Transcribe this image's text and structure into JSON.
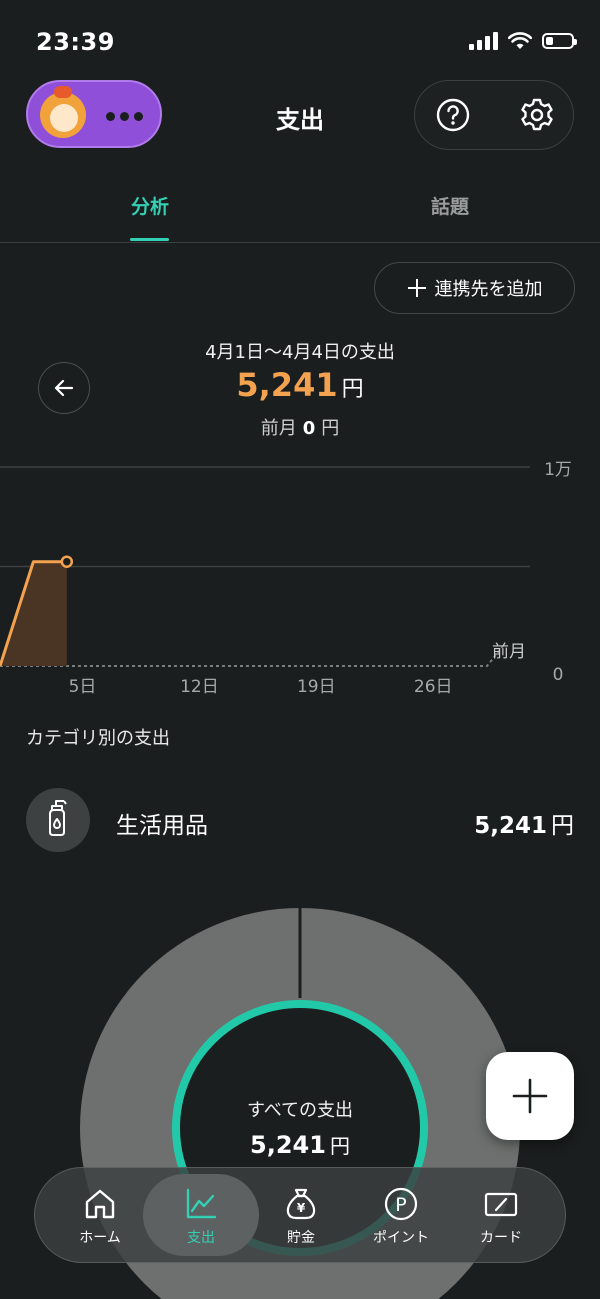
{
  "status_bar": {
    "time": "23:39",
    "battery_level": 0.3
  },
  "header": {
    "title": "支出",
    "icons": [
      "help-icon",
      "gear-icon"
    ],
    "profile_icon": "more-dots-icon"
  },
  "tabs": [
    {
      "label": "分析",
      "active": true
    },
    {
      "label": "話題",
      "active": false
    }
  ],
  "add_link_button": {
    "label": "連携先を追加",
    "icon": "plus-icon"
  },
  "summary": {
    "period": "4月1日〜4月4日の支出",
    "amount": "5,241",
    "currency": "円",
    "previous_label": "前月",
    "previous_amount": "0",
    "previous_currency": "円"
  },
  "chart_data": {
    "type": "line",
    "x_ticks": [
      "5日",
      "12日",
      "19日",
      "26日"
    ],
    "y_ticks": [
      "1万",
      "0"
    ],
    "ylim": [
      0,
      10000
    ],
    "xlim": [
      1,
      31
    ],
    "series": [
      {
        "name": "",
        "x": [
          1,
          2,
          3,
          4
        ],
        "y": [
          0,
          5241,
          5241,
          5241
        ]
      },
      {
        "name": "前月",
        "x": [
          1,
          30
        ],
        "y": [
          0,
          0
        ]
      }
    ],
    "comparison_label": "前月",
    "accent_color": "#f3a24f"
  },
  "categories": {
    "title": "カテゴリ別の支出",
    "items": [
      {
        "name": "生活用品",
        "amount": "5,241",
        "currency": "円",
        "icon": "detergent-bottle-icon"
      }
    ]
  },
  "donut": {
    "label": "すべての支出",
    "amount": "5,241",
    "currency": "円",
    "ring_color": "#22c9a8"
  },
  "fab": {
    "icon": "plus-icon"
  },
  "bottom_nav": [
    {
      "label": "ホーム",
      "icon": "home-icon",
      "active": false
    },
    {
      "label": "支出",
      "icon": "trend-chart-icon",
      "active": true
    },
    {
      "label": "貯金",
      "icon": "money-bag-icon",
      "active": false
    },
    {
      "label": "ポイント",
      "icon": "point-icon",
      "active": false
    },
    {
      "label": "カード",
      "icon": "card-icon",
      "active": false
    }
  ]
}
